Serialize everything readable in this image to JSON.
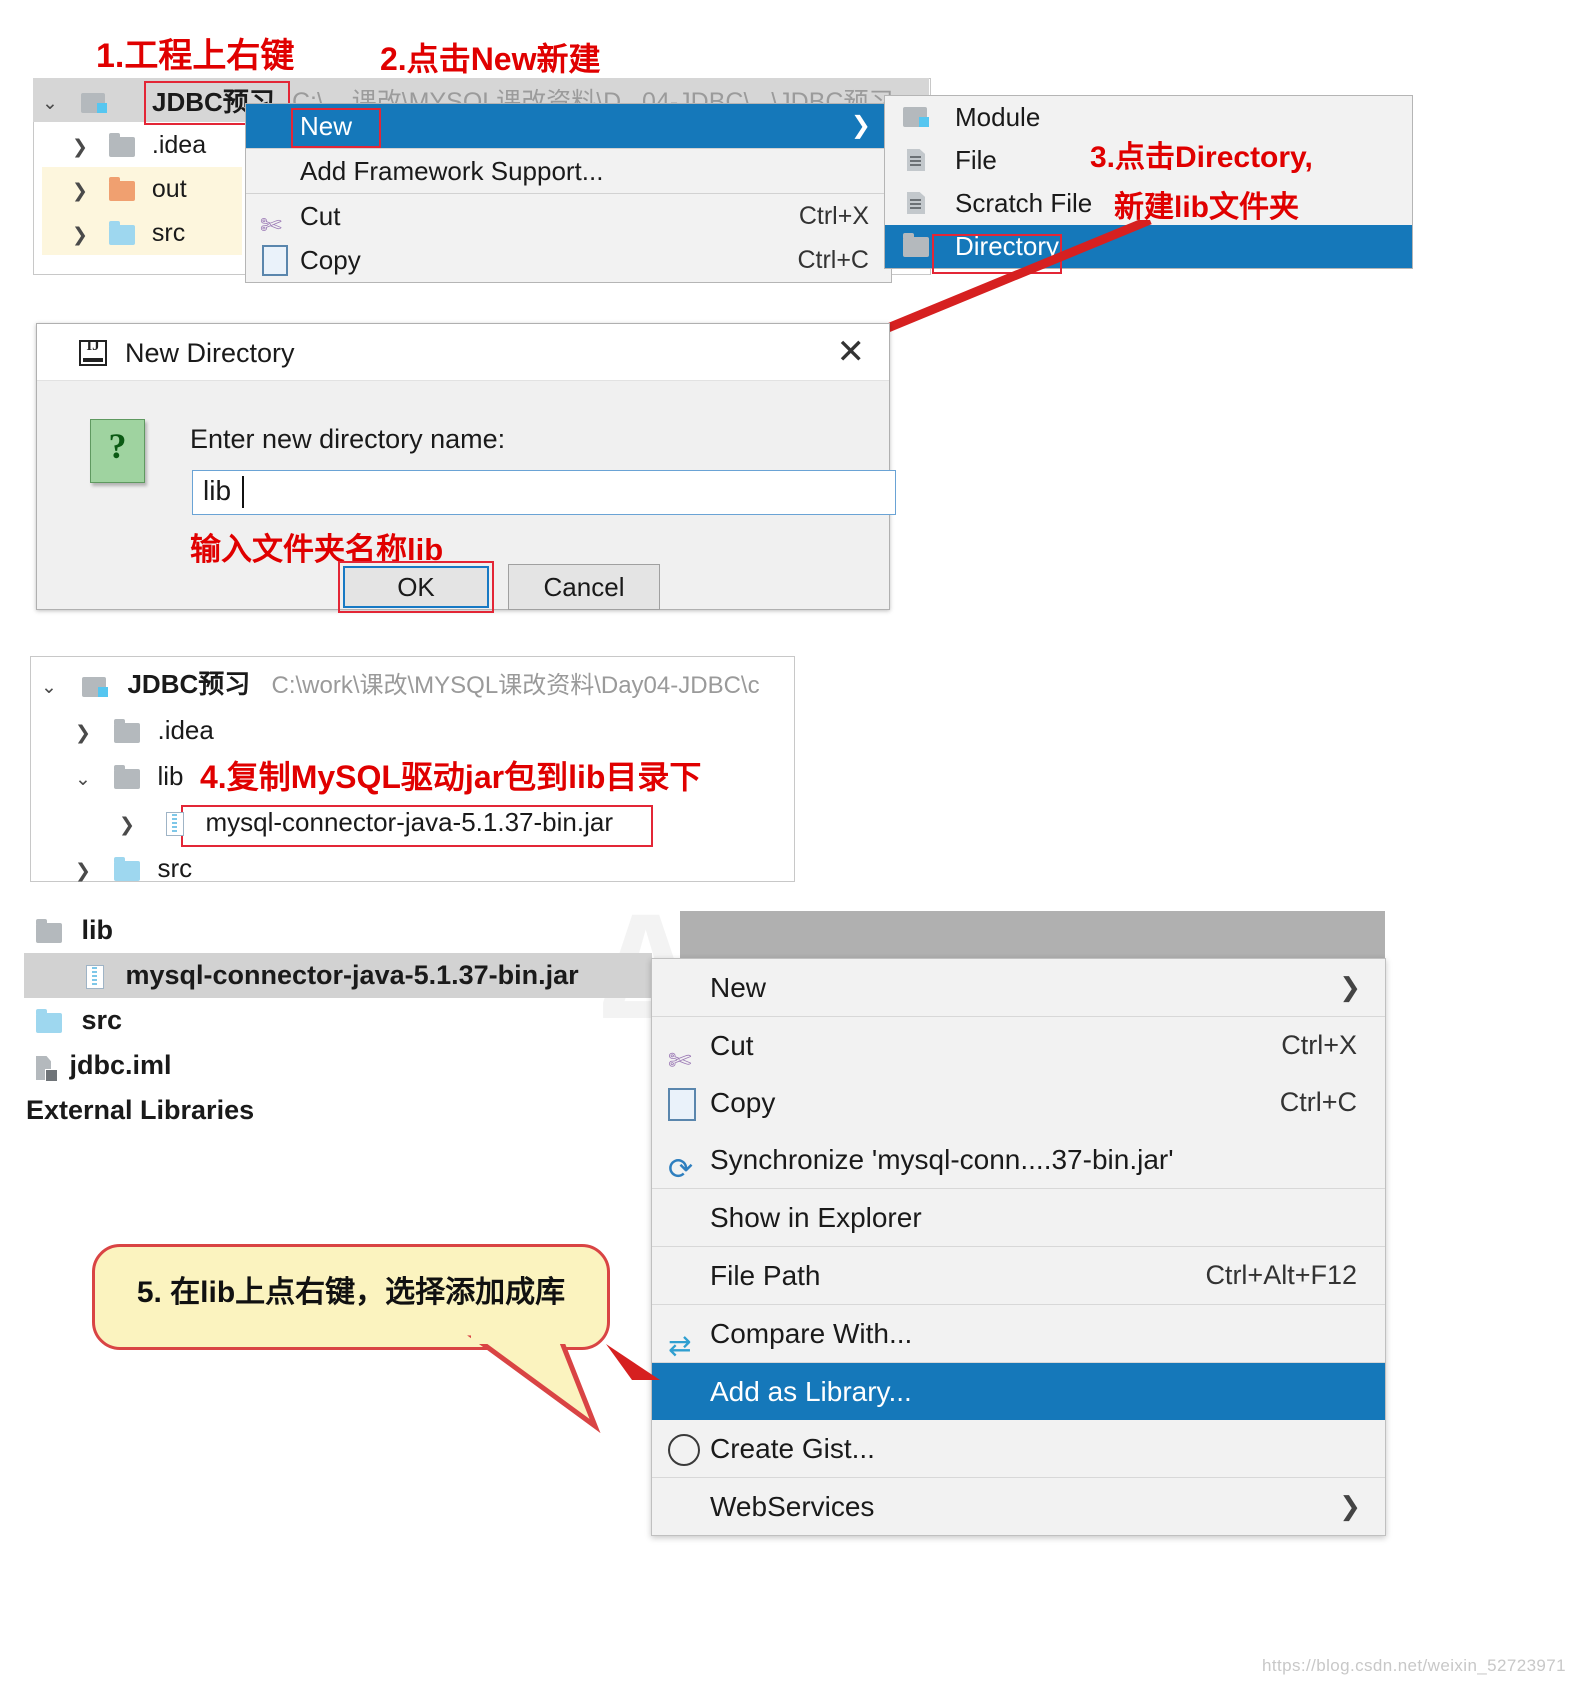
{
  "annotations": {
    "step1": "1.工程上右键",
    "step2": "2.点击New新建",
    "step3_line1": "3.点击Directory,",
    "step3_line2": "新建lib文件夹",
    "dialog_hint": "输入文件夹名称lib",
    "step4": "4.复制MySQL驱动jar包到lib目录下",
    "step5": "5. 在lib上点右键，选择添加成库"
  },
  "project_tree_top": {
    "root": {
      "label": "JDBC预习",
      "icon": "module-icon",
      "expanded": true
    },
    "children": [
      {
        "label": ".idea",
        "icon": "folder-gray-icon"
      },
      {
        "label": "out",
        "icon": "folder-orange-icon"
      },
      {
        "label": "src",
        "icon": "folder-blue-icon"
      }
    ]
  },
  "context_menu_new": {
    "items": [
      {
        "label": "New",
        "icon": "",
        "accel": "",
        "submenu": true,
        "selected": true
      },
      {
        "label": "Add Framework Support...",
        "icon": "",
        "accel": "",
        "submenu": false,
        "selected": false
      },
      {
        "label": "Cut",
        "icon": "scissors-icon",
        "accel": "Ctrl+X",
        "submenu": false,
        "selected": false
      },
      {
        "label": "Copy",
        "icon": "copy-icon",
        "accel": "Ctrl+C",
        "submenu": false,
        "selected": false
      }
    ]
  },
  "submenu_new": {
    "items": [
      {
        "label": "Module",
        "icon": "module-icon",
        "selected": false
      },
      {
        "label": "File",
        "icon": "file-icon",
        "selected": false
      },
      {
        "label": "Scratch File",
        "icon": "scratch-file-icon",
        "selected": false
      },
      {
        "label": "Directory",
        "icon": "folder-gray-icon",
        "selected": true
      }
    ]
  },
  "new_directory_dialog": {
    "title": "New Directory",
    "title_icon": "intellij-idea-icon",
    "question_icon": "?",
    "label": "Enter new directory name:",
    "input_value": "lib",
    "ok_label": "OK",
    "cancel_label": "Cancel",
    "close_label": "✕"
  },
  "project_tree_bottom": {
    "root": {
      "label": "JDBC预习",
      "path": "C:\\work\\课改\\MYSQL课改资料\\Day04-JDBC\\c",
      "expanded": true
    },
    "children": [
      {
        "label": ".idea",
        "icon": "folder-gray-icon",
        "expanded": false,
        "depth": 1
      },
      {
        "label": "lib",
        "icon": "folder-gray-icon",
        "expanded": true,
        "depth": 1
      },
      {
        "label": "mysql-connector-java-5.1.37-bin.jar",
        "icon": "jar-icon",
        "expanded": false,
        "depth": 2
      },
      {
        "label": "src",
        "icon": "folder-blue-icon",
        "expanded": false,
        "depth": 1
      }
    ]
  },
  "file_list": {
    "items": [
      {
        "label": "lib",
        "icon": "folder-gray-icon",
        "indent": 0,
        "selected": false
      },
      {
        "label": "mysql-connector-java-5.1.37-bin.jar",
        "icon": "jar-icon",
        "indent": 1,
        "selected": true
      },
      {
        "label": "src",
        "icon": "folder-blue-icon",
        "indent": 0,
        "selected": false
      },
      {
        "label": "jdbc.iml",
        "icon": "iml-file-icon",
        "indent": 0,
        "selected": false
      },
      {
        "label": "External Libraries",
        "icon": "",
        "indent": 0,
        "selected": false
      }
    ]
  },
  "context_menu_jar": {
    "items": [
      {
        "label": "New",
        "icon": "",
        "accel": "",
        "submenu": true,
        "selected": false
      },
      {
        "label": "Cut",
        "icon": "scissors-icon",
        "accel": "Ctrl+X",
        "submenu": false,
        "selected": false
      },
      {
        "label": "Copy",
        "icon": "copy-icon",
        "accel": "Ctrl+C",
        "submenu": false,
        "selected": false
      },
      {
        "label": "Synchronize 'mysql-conn....37-bin.jar'",
        "icon": "sync-icon",
        "accel": "",
        "submenu": false,
        "selected": false
      },
      {
        "label": "Show in Explorer",
        "icon": "",
        "accel": "",
        "submenu": false,
        "selected": false
      },
      {
        "label": "File Path",
        "icon": "",
        "accel": "Ctrl+Alt+F12",
        "submenu": false,
        "selected": false
      },
      {
        "label": "Compare With...",
        "icon": "compare-icon",
        "accel": "",
        "submenu": false,
        "selected": false
      },
      {
        "label": "Add as Library...",
        "icon": "",
        "accel": "",
        "submenu": false,
        "selected": true
      },
      {
        "label": "Create Gist...",
        "icon": "github-icon",
        "accel": "",
        "submenu": false,
        "selected": false
      },
      {
        "label": "WebServices",
        "icon": "",
        "accel": "",
        "submenu": true,
        "selected": false
      }
    ]
  },
  "watermark": {
    "url": "https://blog.csdn.net/weixin_52723971"
  },
  "colors": {
    "selection_blue": "#1578ba",
    "annotation_red": "#e00000",
    "callout_bg": "#fbf3bf",
    "callout_border": "#d94444"
  }
}
